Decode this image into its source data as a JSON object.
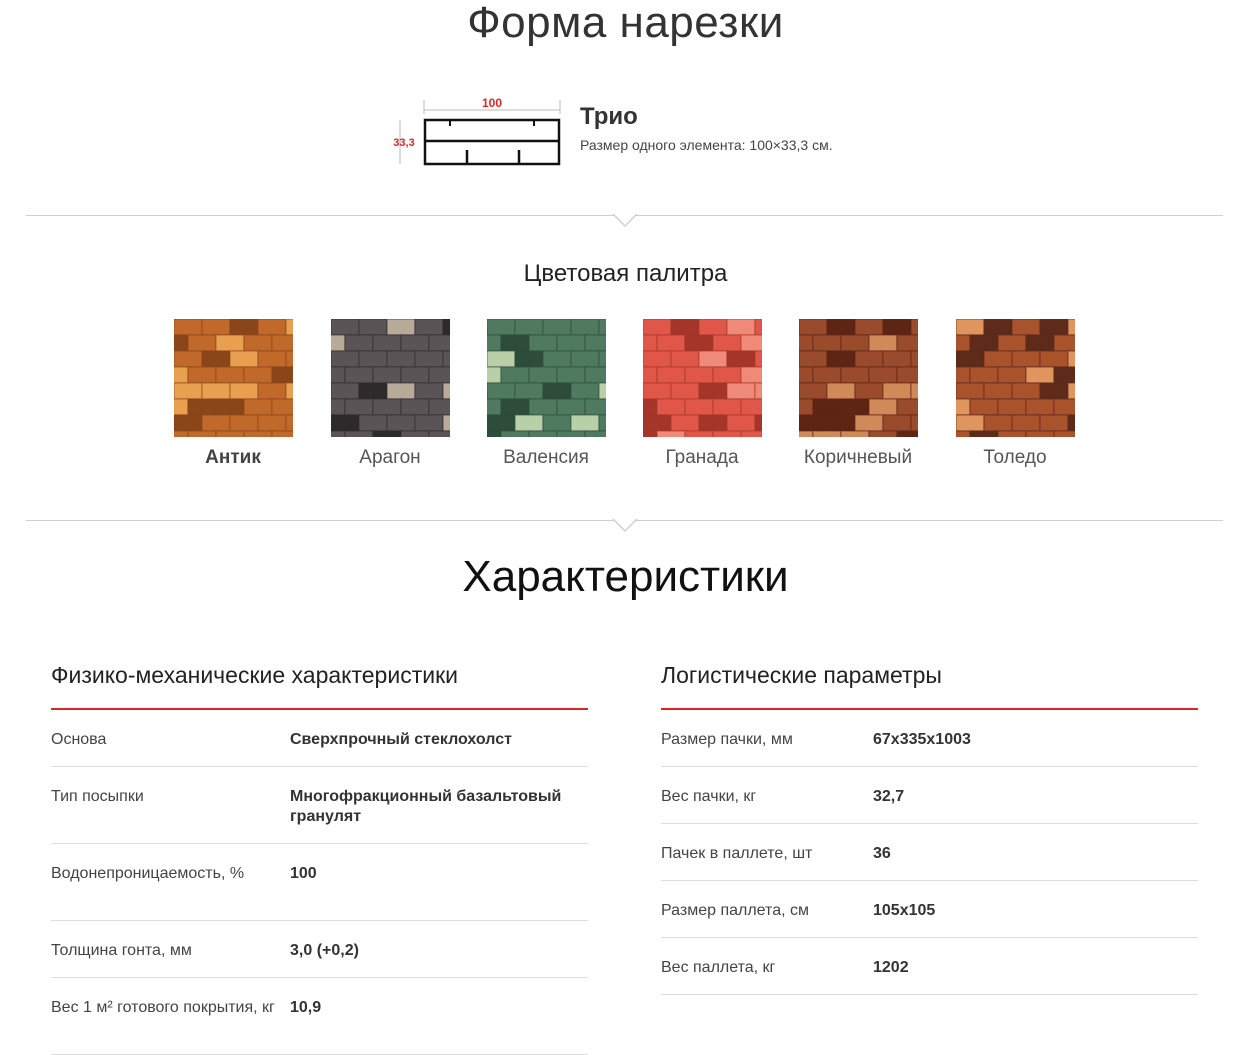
{
  "section_cut": {
    "title": "Форма нарезки",
    "shape_name": "Трио",
    "shape_size": "Размер одного элемента: 100×33,3 см.",
    "dim_width": "100",
    "dim_height": "33,3"
  },
  "palette": {
    "title": "Цветовая палитра",
    "colors": [
      {
        "label": "Антик",
        "active": true,
        "base": "#c0692a",
        "dark": "#8a4518",
        "light": "#e8a050"
      },
      {
        "label": "Арагон",
        "active": false,
        "base": "#5a5456",
        "dark": "#2e2a2c",
        "light": "#b7aa98"
      },
      {
        "label": "Валенсия",
        "active": false,
        "base": "#4f7a60",
        "dark": "#2d4c3a",
        "light": "#b9cfa8"
      },
      {
        "label": "Гранада",
        "active": false,
        "base": "#e0574a",
        "dark": "#a53429",
        "light": "#f08a78"
      },
      {
        "label": "Коричневый",
        "active": false,
        "base": "#9a4b2b",
        "dark": "#5e2514",
        "light": "#d08a5a"
      },
      {
        "label": "Толедо",
        "active": false,
        "base": "#a8532c",
        "dark": "#5e2a1a",
        "light": "#e0955e"
      }
    ]
  },
  "characteristics": {
    "title": "Характеристики",
    "physical": {
      "title": "Физико-механические характеристики",
      "rows": [
        {
          "key": "Основа",
          "value": "Сверхпрочный стеклохолст"
        },
        {
          "key": "Тип посыпки",
          "value": "Многофракционный базальтовый гранулят"
        },
        {
          "key": "Водонепроницаемость, %",
          "value": "100"
        },
        {
          "key": "Толщина гонта, мм",
          "value": "3,0 (+0,2)"
        },
        {
          "key": "Вес 1 м² готового покрытия, кг",
          "value": "10,9"
        }
      ]
    },
    "logistics": {
      "title": "Логистические параметры",
      "rows": [
        {
          "key": "Размер пачки, мм",
          "value": "67x335x1003"
        },
        {
          "key": "Вес пачки, кг",
          "value": "32,7"
        },
        {
          "key": "Пачек в паллете, шт",
          "value": "36"
        },
        {
          "key": "Размер паллета, см",
          "value": "105x105"
        },
        {
          "key": "Вес паллета, кг",
          "value": "1202"
        }
      ]
    }
  },
  "colors": {
    "accent_red": "#e02424",
    "divider": "#dddddd"
  }
}
